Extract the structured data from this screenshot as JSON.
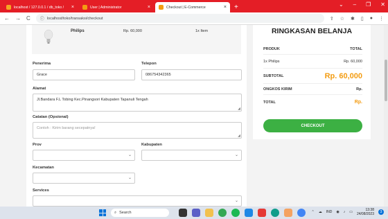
{
  "browser": {
    "tabs": [
      {
        "label": "localhost / 127.0.0.1 / db_toko / ",
        "favicon_color": "#f5a623",
        "active": false
      },
      {
        "label": "User | Administrator",
        "favicon_color": "#f39c12",
        "active": false
      },
      {
        "label": "Checkout | E-Commerce",
        "favicon_color": "#f39c12",
        "active": true
      }
    ],
    "new_tab": "+",
    "url": "localhost/toko/transaksi/checkout"
  },
  "product": {
    "name": "Philips",
    "price": "Rp. 60,000",
    "qty": "1x Item"
  },
  "form": {
    "penerima_label": "Penerima",
    "penerima_value": "Grace",
    "telepon_label": "Telepon",
    "telepon_value": "086754342365",
    "alamat_label": "Alamat",
    "alamat_value": "Jl.Bandara F.L Tobing Kec.Pinangsori Kabupaten Tapanuli Tengah",
    "catatan_label": "Catatan (Opsional)",
    "catatan_placeholder": "Contoh : Kirim barang secepatnya!",
    "prov_label": "Prov",
    "kabupaten_label": "Kabupaten",
    "kecamatan_label": "Kecamatan",
    "services_label": "Services"
  },
  "summary": {
    "title": "RINGKASAN BELANJA",
    "produk_header": "PRODUK",
    "total_header": "TOTAL",
    "item_name": "1x Philips",
    "item_price": "Rp. 60,000",
    "subtotal_label": "SUBTOTAL",
    "subtotal_value": "Rp. 60,000",
    "ongkos_label": "ONGKOS KIRIM",
    "ongkos_value": "Rp.",
    "total_label": "TOTAL",
    "total_value": "Rp.",
    "checkout_label": "CHECKOUT",
    "accent_color": "#f39c12",
    "button_color": "#3cb043"
  },
  "taskbar": {
    "search_label": "Search",
    "language": "IND",
    "time": "13:38",
    "date": "24/08/2023",
    "notification_count": "3"
  }
}
